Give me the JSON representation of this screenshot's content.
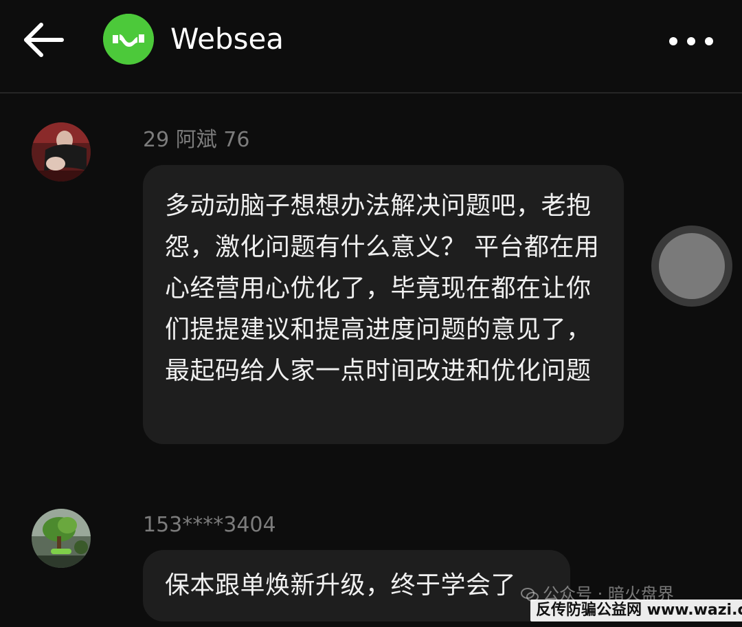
{
  "header": {
    "back_icon": "arrow-left-icon",
    "title": "Websea",
    "logo_color": "#4cc93a",
    "more_icon": "more-horizontal-icon"
  },
  "messages": [
    {
      "sender": "29 阿斌 76",
      "avatar": "user-photo",
      "text": "多动动脑子想想办法解决问题吧，老抱怨，激化问题有什么意义？ 平台都在用心经营用心优化了，毕竟现在都在让你们提提建议和提高进度问题的意见了，最起码给人家一点时间改进和优化问题"
    },
    {
      "sender": "153****3404",
      "avatar": "tree-photo",
      "text": "保本跟单焕新升级，终于学会了"
    }
  ],
  "floating_button": {
    "icon": "assistive-touch-icon"
  },
  "watermarks": {
    "wechat": "公众号 · 暗火盘界",
    "site": "反传防骗公益网 www.wazi.cc"
  },
  "colors": {
    "background": "#0d0d0d",
    "bubble": "#1e1e1e",
    "sender_text": "#7c7c7c",
    "message_text": "#f0f0f0"
  }
}
